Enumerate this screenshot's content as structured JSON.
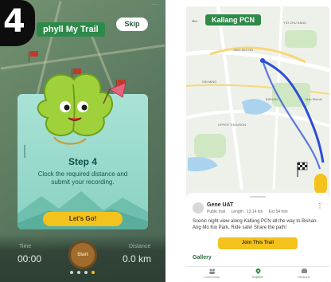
{
  "left_screen": {
    "step_badge": "4",
    "status_text": "···",
    "title": "phyll My Trail",
    "skip_label": "Skip",
    "card": {
      "title": "Step 4",
      "description": "Clock the required distance and submit your recording.",
      "button_label": "Let's Go!"
    },
    "stats": {
      "time_label": "Time",
      "time_value": "00:00",
      "distance_label": "Distance",
      "distance_value": "0.0 km"
    },
    "record_button_label": "Start",
    "pager": {
      "count": 4,
      "active_index": 3
    },
    "colors": {
      "accent": "#f4c21c",
      "title_green": "#2d8a4a",
      "card_bg": "#a9e3d6"
    }
  },
  "right_screen": {
    "title": "Kallang PCN",
    "user": {
      "name": "Gene UAT",
      "visibility": "Public trail",
      "length": "Length : 13.14 km",
      "duration": "Est 54 min"
    },
    "description": "Scenic night view along Kallang PCN all the way to Bishan-Ang Mo Kio Park. Ride safe! Share the path!",
    "join_label": "Join This Trail",
    "gallery_label": "Gallery",
    "tabs": [
      {
        "label": "Community",
        "icon": "community-icon"
      },
      {
        "label": "Explore",
        "icon": "map-pin-icon"
      },
      {
        "label": "Missions",
        "icon": "missions-icon"
      }
    ],
    "map_labels": {
      "l1": "YIO CHU KANG",
      "l2": "ANG MO KIO",
      "l3": "BISHAN",
      "l4": "SIN MING",
      "l5": "UPPER THOMSON",
      "l6": "Mac Ritchie"
    },
    "colors": {
      "route": "#2b4fd6",
      "accent": "#f4c21c",
      "title_green": "#2f8a48"
    }
  }
}
